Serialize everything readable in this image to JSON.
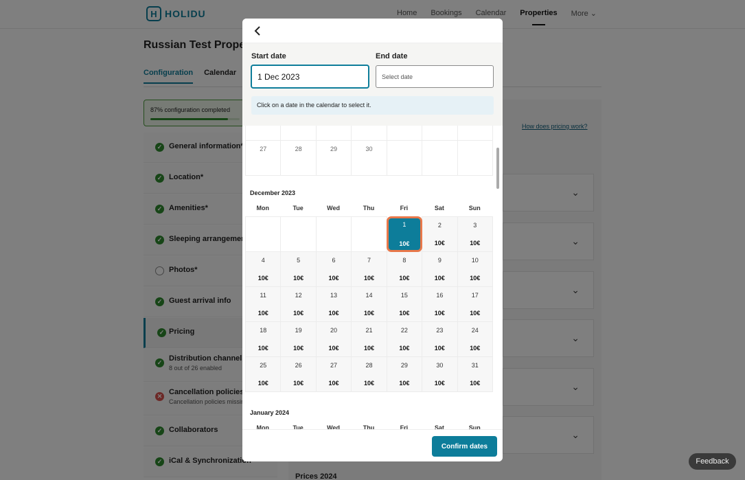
{
  "brand": {
    "logo_letter": "H",
    "name": "HOLIDU"
  },
  "nav": {
    "items": [
      "Home",
      "Bookings",
      "Calendar",
      "Properties",
      "More ⌄"
    ],
    "active_index": 3
  },
  "page": {
    "title": "Russian Test Property",
    "tabs": [
      "Configuration",
      "Calendar"
    ],
    "progress_text": "87% configuration completed",
    "progress_percent": 87,
    "pricing_link": "How does pricing work?",
    "prices_heading": "Prices 2024"
  },
  "sidebar": {
    "items": [
      {
        "label": "General information*",
        "status": "ok"
      },
      {
        "label": "Location*",
        "status": "ok"
      },
      {
        "label": "Amenities*",
        "status": "ok"
      },
      {
        "label": "Sleeping arrangements",
        "status": "ok"
      },
      {
        "label": "Photos*",
        "status": "empty"
      },
      {
        "label": "Guest arrival info",
        "status": "ok"
      },
      {
        "label": "Pricing",
        "status": "ok"
      },
      {
        "label": "Distribution channels",
        "sub": "8 out of 26 enabled",
        "status": "ok"
      },
      {
        "label": "Cancellation policies",
        "sub": "Cancellation policies missing",
        "status": "err"
      },
      {
        "label": "Collaborators",
        "status": "ok"
      },
      {
        "label": "iCal & Synchronization",
        "status": "ok"
      }
    ]
  },
  "modal": {
    "start_label": "Start date",
    "start_value": "1 Dec 2023",
    "end_label": "End date",
    "end_placeholder": "Select date",
    "hint": "Click on a date in the calendar to select it.",
    "confirm_label": "Confirm dates"
  },
  "calendar": {
    "weekdays": [
      "Mon",
      "Tue",
      "Wed",
      "Thu",
      "Fri",
      "Sat",
      "Sun"
    ],
    "november_tail": [
      27,
      28,
      29,
      30
    ],
    "december": {
      "title": "December 2023",
      "first_weekday_index": 4,
      "days": 31,
      "price": "10€",
      "selected_day": 1
    },
    "january": {
      "title": "January 2024"
    }
  },
  "feedback_label": "Feedback"
}
